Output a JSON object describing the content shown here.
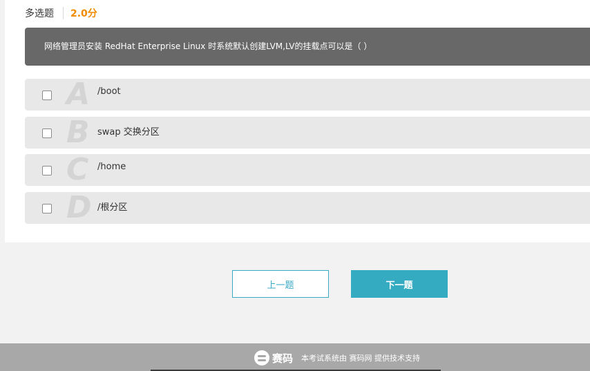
{
  "question": {
    "type_label": "多选题",
    "score": "2.0分",
    "stem": "网络管理员安装 RedHat Enterprise Linux 时系统默认创建LVM,LV的挂载点可以是（    ）"
  },
  "options": [
    {
      "letter": "A",
      "text": "/boot"
    },
    {
      "letter": "B",
      "text": "swap 交换分区"
    },
    {
      "letter": "C",
      "text": "/home"
    },
    {
      "letter": "D",
      "text": "/根分区"
    }
  ],
  "nav": {
    "prev_label": "上一题",
    "next_label": "下一题"
  },
  "footer": {
    "brand_name": "赛码",
    "support_text": "本考试系统由 赛码网 提供技术支持"
  },
  "colors": {
    "accent": "#35abc2",
    "score": "#f08a00",
    "stem_bg": "#686868",
    "option_bg": "#e8e8e8",
    "footer_bg": "#a8a8a8"
  }
}
